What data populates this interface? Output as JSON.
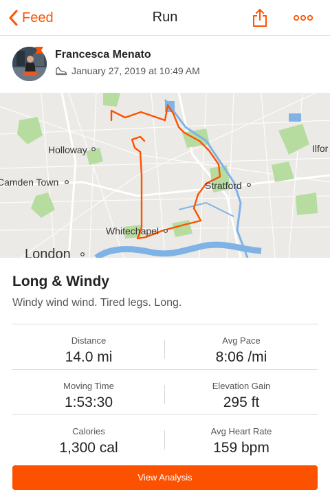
{
  "nav": {
    "back_label": "Feed",
    "title": "Run"
  },
  "athlete": {
    "name": "Francesca Menato",
    "datetime": "January 27, 2019 at 10:49 AM"
  },
  "map": {
    "places": {
      "holloway": "Holloway",
      "camden": "Camden Town",
      "stratford": "Stratford",
      "whitechapel": "Whitechapel",
      "london": "London",
      "ilford": "Ilfor"
    },
    "route_color": "#fc5200"
  },
  "activity": {
    "title": "Long & Windy",
    "description": "Windy wind wind. Tired legs. Long."
  },
  "stats": {
    "distance": {
      "label": "Distance",
      "value": "14.0 mi"
    },
    "avg_pace": {
      "label": "Avg Pace",
      "value": "8:06 /mi"
    },
    "moving_time": {
      "label": "Moving Time",
      "value": "1:53:30"
    },
    "elevation_gain": {
      "label": "Elevation Gain",
      "value": "295 ft"
    },
    "calories": {
      "label": "Calories",
      "value": "1,300 cal"
    },
    "avg_heart_rate": {
      "label": "Avg Heart Rate",
      "value": "159 bpm"
    }
  },
  "cta": {
    "label": "View Analysis"
  },
  "colors": {
    "accent": "#fc5200",
    "park": "#b7dca0",
    "water": "#7fb3e6",
    "land": "#eceae6"
  }
}
